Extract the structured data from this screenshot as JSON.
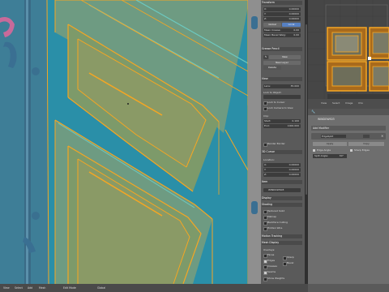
{
  "npanel": {
    "transform_header": "Transform",
    "transform_fields": [
      {
        "label": "X:",
        "value": "0.00000"
      },
      {
        "label": "Y:",
        "value": "0.00000"
      },
      {
        "label": "Z:",
        "value": "0.00000"
      }
    ],
    "global_label": "Global",
    "local_label": "Local",
    "mean_crease": {
      "label": "Mean Crease:",
      "value": "0.00"
    },
    "mean_bevel": {
      "label": "Mean Bevel Weig:",
      "value": "0.00"
    },
    "grease_pencil_header": "Grease Pencil",
    "new_label": "New",
    "new_layer_label": "New Layer",
    "delete_label": "Delete",
    "view_header": "View",
    "lens": {
      "label": "Lens:",
      "value": "35.000"
    },
    "lock_to_object_label": "Lock to Object:",
    "lock_to_cursor_label": "Lock to Cursor",
    "lock_camera_label": "Lock Camera to View",
    "clip_label": "Clip:",
    "clip_start": {
      "label": "Start:",
      "value": "0.100"
    },
    "clip_end": {
      "label": "End:",
      "value": "1000.000"
    },
    "render_border_label": "Render Border",
    "cursor_header": "3D Cursor",
    "location_label": "Location:",
    "cursor_fields": [
      {
        "label": "X:",
        "value": "0.00000"
      },
      {
        "label": "Y:",
        "value": "0.00000"
      },
      {
        "label": "Z:",
        "value": "0.00000"
      }
    ],
    "item_header": "Item",
    "item_name": "WINDOWS03",
    "display_header": "Display",
    "shading_header": "Shading",
    "shading_options": [
      "Textured Solid",
      "Matcap",
      "Backface Culling",
      "Hidden Wire"
    ],
    "motion_tracking_header": "Motion Tracking",
    "mesh_display_header": "Mesh Display",
    "overlays_label": "Overlays:",
    "overlays_left": [
      "Faces",
      "Edges",
      "Creases",
      "Seams"
    ],
    "overlays_right": [
      "Sharp",
      "Bevel"
    ],
    "show_weights_label": "Show Weights"
  },
  "properties": {
    "tabs": [
      "View",
      "Select",
      "Image",
      "UVs"
    ],
    "object_name": "WINDOWS03",
    "add_modifier_label": "Add Modifier",
    "modifier_name": "EdgeSplit",
    "apply_label": "Apply",
    "copy_label": "Copy",
    "edge_angle_label": "Edge Angle",
    "sharp_edges_label": "Sharp Edges",
    "split_angle": {
      "label": "Split Angle:",
      "value": "30°"
    }
  },
  "bottombar": {
    "items": [
      "View",
      "Select",
      "Add",
      "Mesh"
    ],
    "mode_label": "Edit Mode",
    "pivot_label": "Global"
  },
  "colors": {
    "viewport_bg": "#8f8f8f",
    "mesh_teal": "#2a8fa8",
    "panel_inner": "#7d9a6a",
    "selected_edge": "#f5a623",
    "shutter_blue": "#2d6f8f"
  }
}
